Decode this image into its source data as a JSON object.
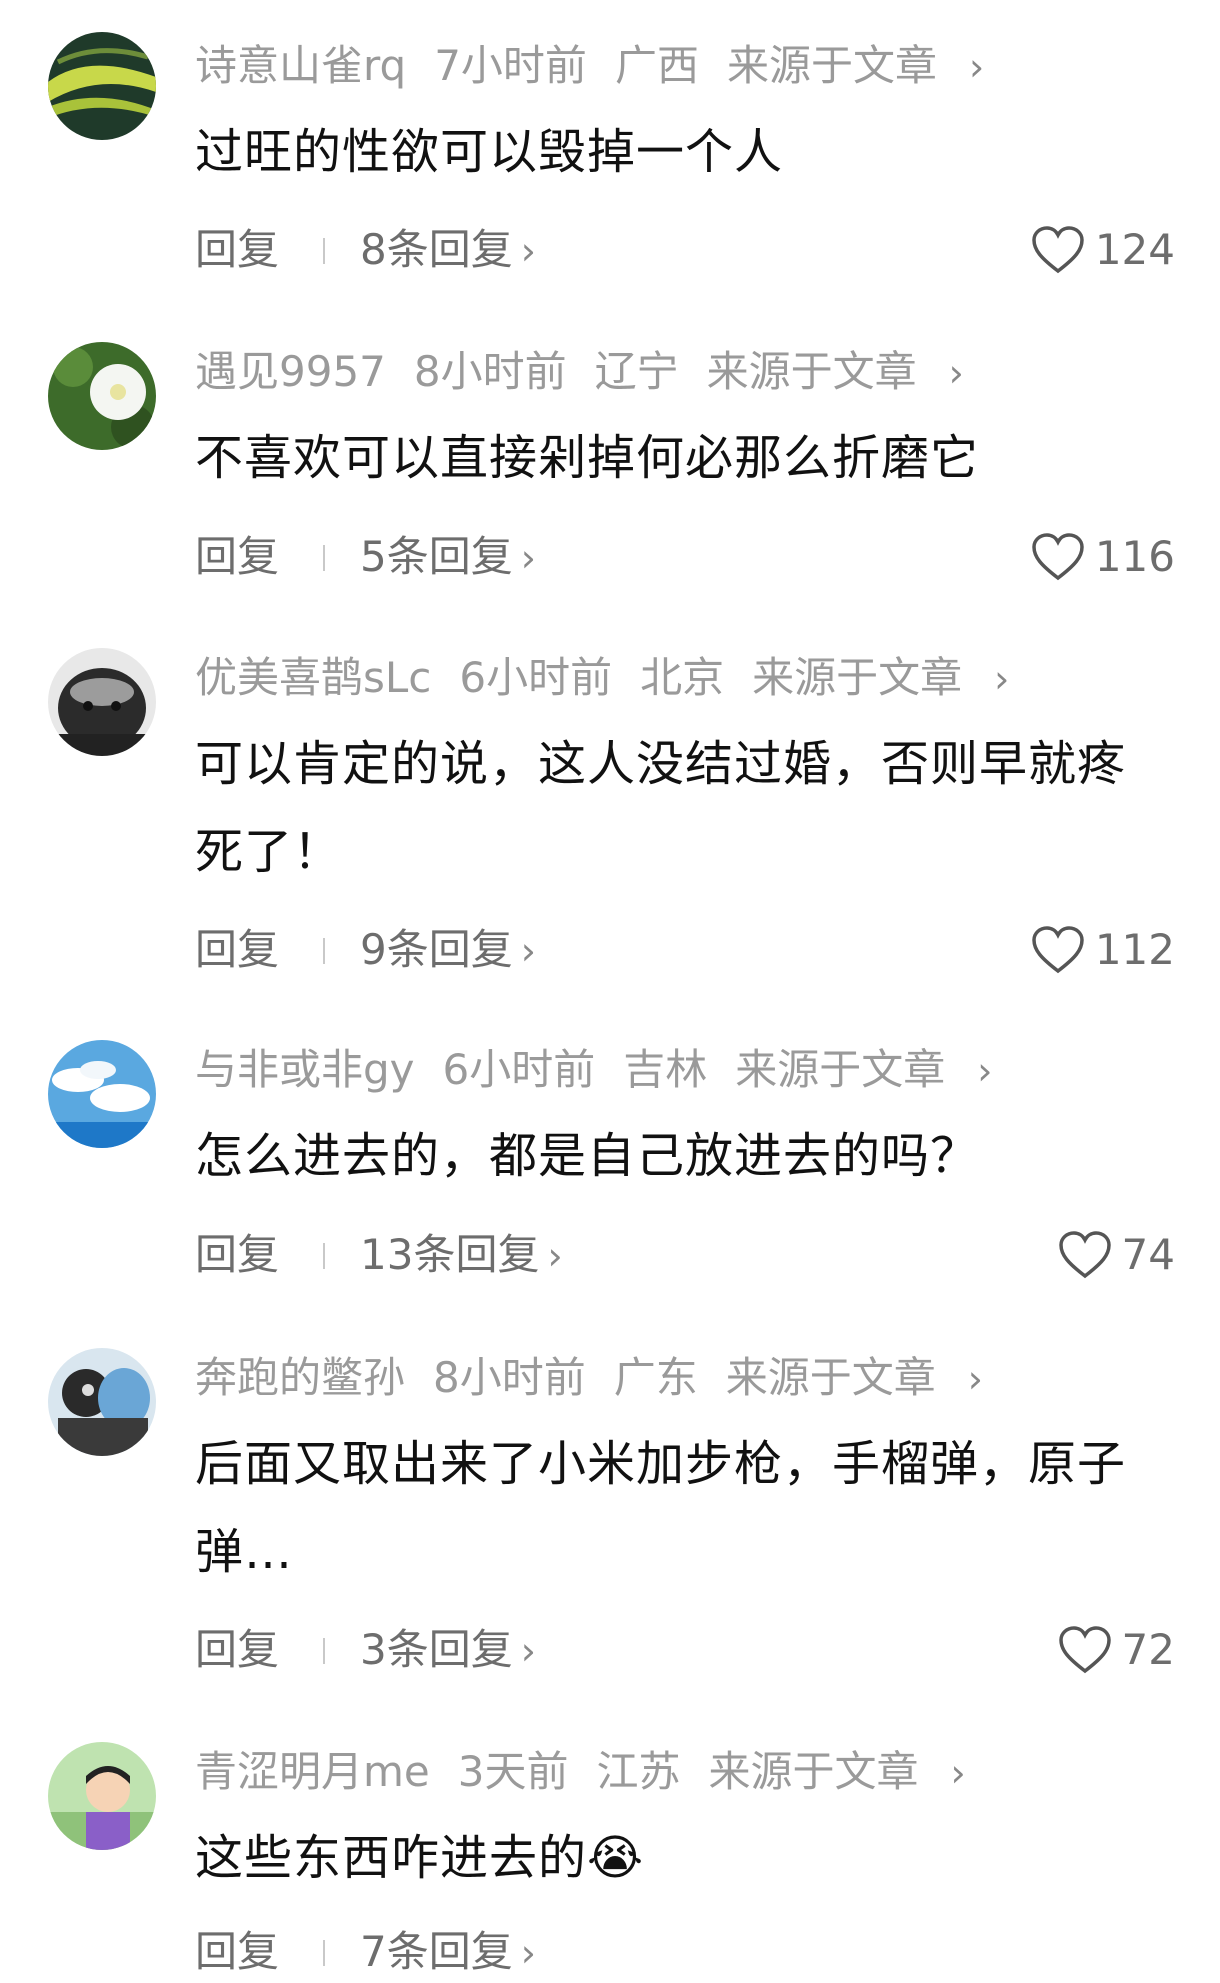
{
  "comments": [
    {
      "username": "诗意山雀rq",
      "time": "7小时前",
      "location": "广西",
      "source": "来源于文章",
      "text": "过旺的性欲可以毁掉一个人",
      "reply_label": "回复",
      "replies": "8条回复",
      "likes": "124"
    },
    {
      "username": "遇见9957",
      "time": "8小时前",
      "location": "辽宁",
      "source": "来源于文章",
      "text": "不喜欢可以直接剁掉何必那么折磨它",
      "reply_label": "回复",
      "replies": "5条回复",
      "likes": "116"
    },
    {
      "username": "优美喜鹊sLc",
      "time": "6小时前",
      "location": "北京",
      "source": "来源于文章",
      "text": "可以肯定的说，这人没结过婚，否则早就疼死了！",
      "reply_label": "回复",
      "replies": "9条回复",
      "likes": "112"
    },
    {
      "username": "与非或非gy",
      "time": "6小时前",
      "location": "吉林",
      "source": "来源于文章",
      "text": "怎么进去的，都是自己放进去的吗？",
      "reply_label": "回复",
      "replies": "13条回复",
      "likes": "74"
    },
    {
      "username": "奔跑的鳖孙",
      "time": "8小时前",
      "location": "广东",
      "source": "来源于文章",
      "text": "后面又取出来了小米加步枪，手榴弹，原子弹…",
      "reply_label": "回复",
      "replies": "3条回复",
      "likes": "72"
    },
    {
      "username": "青涩明月me",
      "time": "3天前",
      "location": "江苏",
      "source": "来源于文章",
      "text": "这些东西咋进去的😭",
      "reply_label": "回复",
      "replies": "7条回复",
      "likes": ""
    }
  ],
  "icons": {
    "chevron": "chevron-right-icon",
    "like": "heart-outline-icon"
  },
  "colors": {
    "meta_text": "#9a9a9a",
    "body_text": "#111111",
    "action_text": "#6d6d6d"
  }
}
